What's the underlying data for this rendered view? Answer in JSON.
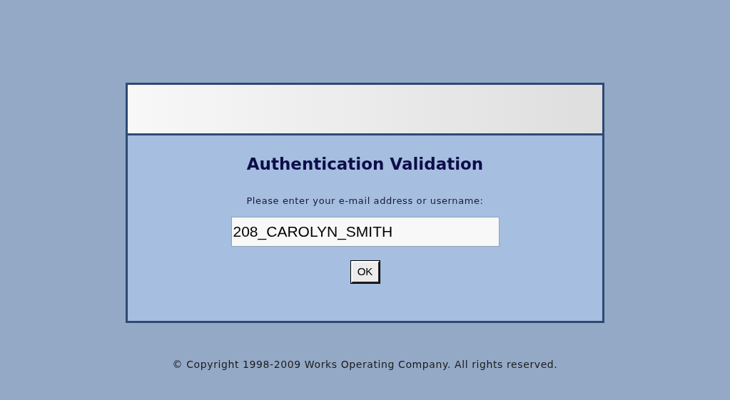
{
  "dialog": {
    "title": "Authentication Validation",
    "prompt": "Please enter your e-mail address or username:",
    "username_field": {
      "value": "208_CAROLYN_SMITH"
    },
    "ok_button": "OK"
  },
  "footer": "© Copyright 1998-2009 Works Operating Company. All rights reserved."
}
